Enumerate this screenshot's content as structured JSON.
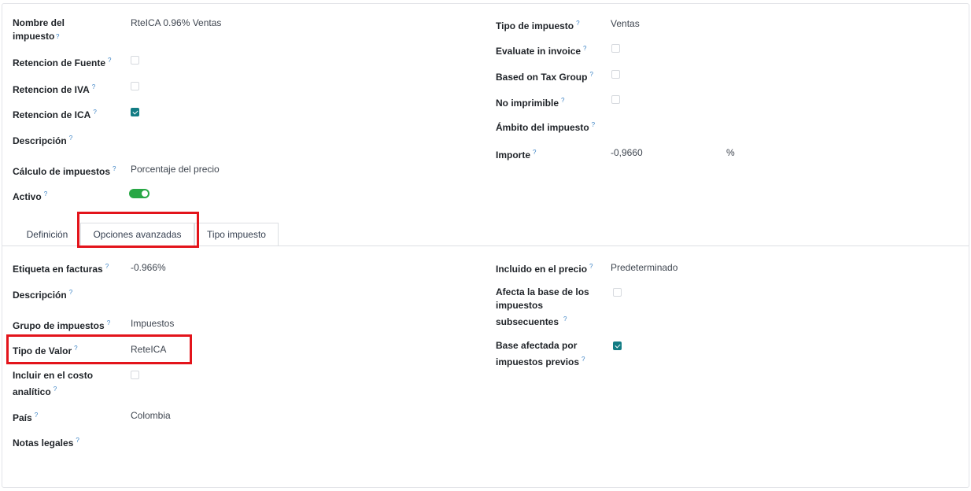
{
  "header_left": {
    "nombre_label": "Nombre del impuesto",
    "nombre_value": "RteICA 0.96% Ventas",
    "ret_fuente_label": "Retencion de Fuente",
    "ret_iva_label": "Retencion de IVA",
    "ret_ica_label": "Retencion de ICA",
    "descripcion_label": "Descripción",
    "calculo_label": "Cálculo de impuestos",
    "calculo_value": "Porcentaje del precio",
    "activo_label": "Activo"
  },
  "header_right": {
    "tipo_impuesto_label": "Tipo de impuesto",
    "tipo_impuesto_value": "Ventas",
    "evaluate_label": "Evaluate in invoice",
    "based_label": "Based on Tax Group",
    "no_imprimible_label": "No imprimible",
    "ambito_label": "Ámbito del impuesto",
    "importe_label": "Importe",
    "importe_value": "-0,9660",
    "importe_unit": "%"
  },
  "checkboxes": {
    "ret_fuente": false,
    "ret_iva": false,
    "ret_ica": true,
    "evaluate": false,
    "based": false,
    "no_imprimible": false,
    "afecta_base": false,
    "base_afectada": true,
    "incluir_costo": false
  },
  "activo_on": true,
  "help_mark": "?",
  "tabs": [
    "Definición",
    "Opciones avanzadas",
    "Tipo impuesto"
  ],
  "active_tab": "Opciones avanzadas",
  "advanced_left": {
    "etiqueta_label": "Etiqueta en facturas",
    "etiqueta_value": "-0.966%",
    "descripcion_label": "Descripción",
    "grupo_label": "Grupo de impuestos",
    "grupo_value": "Impuestos",
    "tipo_valor_label": "Tipo de Valor",
    "tipo_valor_value": "ReteICA",
    "incluir_label_1": "Incluir en el costo",
    "incluir_label_2": "analítico",
    "pais_label": "País",
    "pais_value": "Colombia",
    "notas_label": "Notas legales"
  },
  "advanced_right": {
    "incluido_label": "Incluido en el precio",
    "incluido_value": "Predeterminado",
    "afecta_label_1": "Afecta la base de los",
    "afecta_label_2": "impuestos",
    "afecta_label_3": "subsecuentes",
    "base_label_1": "Base afectada por",
    "base_label_2": "impuestos previos"
  },
  "highlight_color": "#e3141b",
  "accent_color": "#127c84"
}
